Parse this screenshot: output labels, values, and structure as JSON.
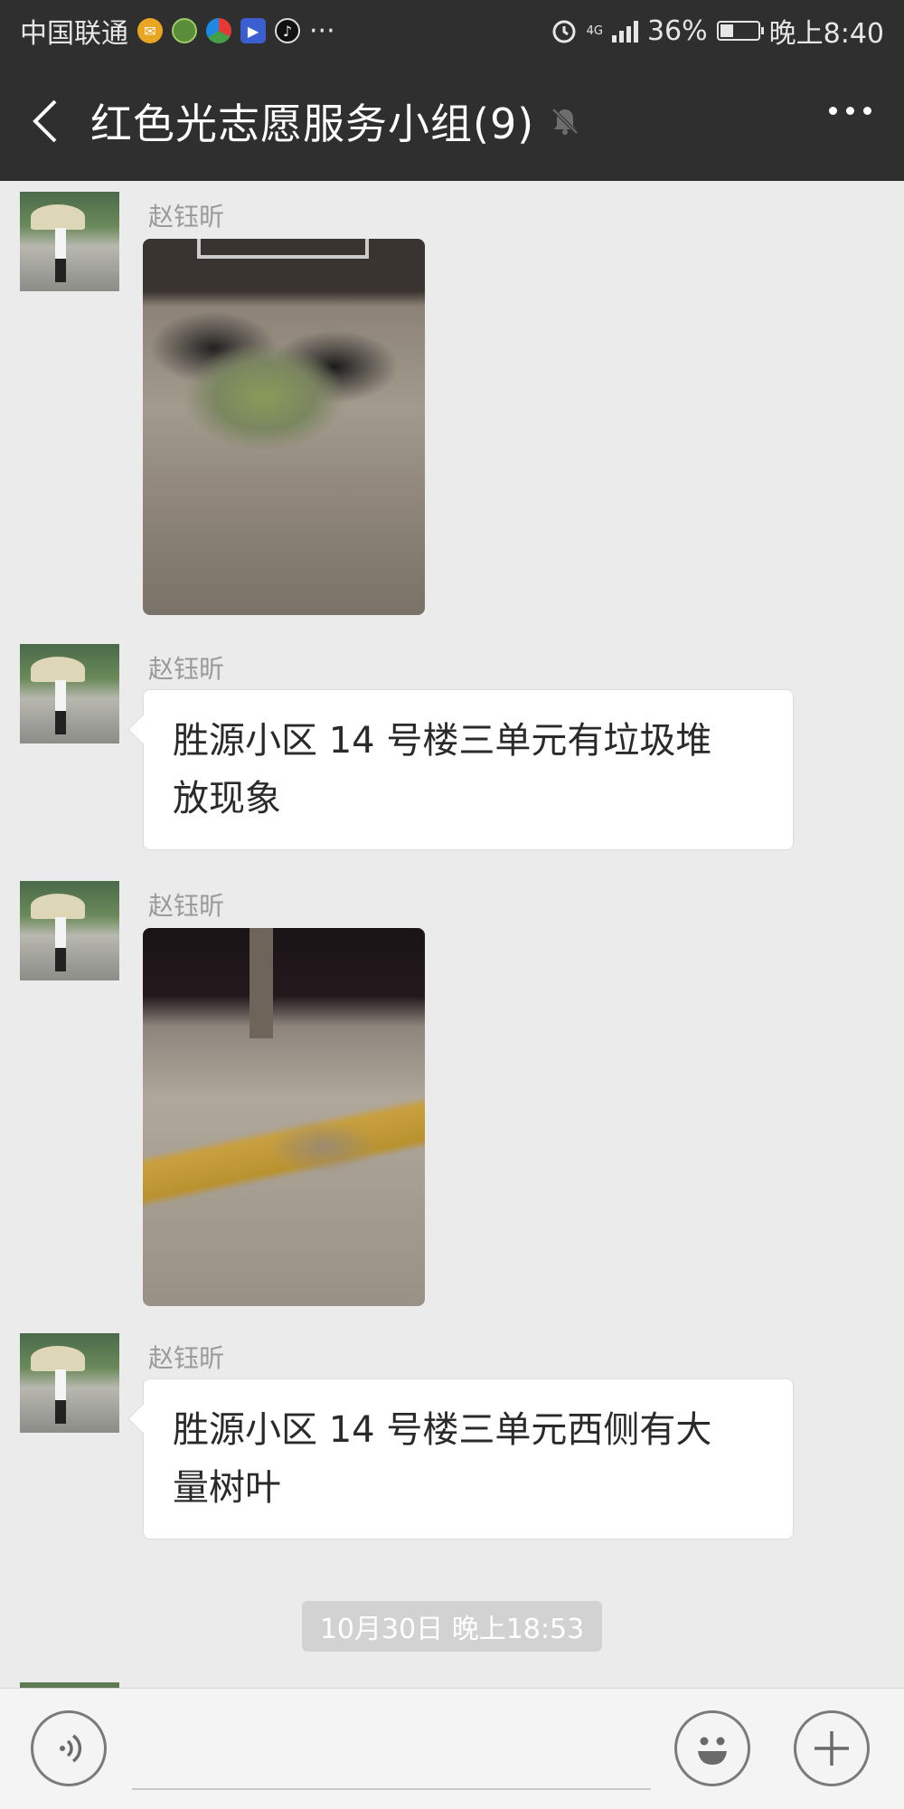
{
  "status_bar": {
    "carrier": "中国联通",
    "more_indicator": "···",
    "network": "4G",
    "battery_percent": "36%",
    "battery_level": 0.36,
    "time": "晚上8:40"
  },
  "header": {
    "title": "红色光志愿服务小组(9)",
    "icons": [
      "back-arrow-icon",
      "mute-bell-icon",
      "more-dots-icon"
    ]
  },
  "messages": [
    {
      "sender": "赵钰昕",
      "type": "image"
    },
    {
      "sender": "赵钰昕",
      "type": "text",
      "text_line1": "胜源小区 14 号楼三单元有垃圾堆",
      "text_line2": "放现象"
    },
    {
      "sender": "赵钰昕",
      "type": "image"
    },
    {
      "sender": "赵钰昕",
      "type": "text",
      "text_line1": "胜源小区 14 号楼三单元西侧有大",
      "text_line2": "量树叶"
    }
  ],
  "timestamp": "10月30日 晚上18:53",
  "input_bar": {
    "icons": [
      "voice-icon",
      "emoji-icon",
      "plus-icon"
    ]
  }
}
